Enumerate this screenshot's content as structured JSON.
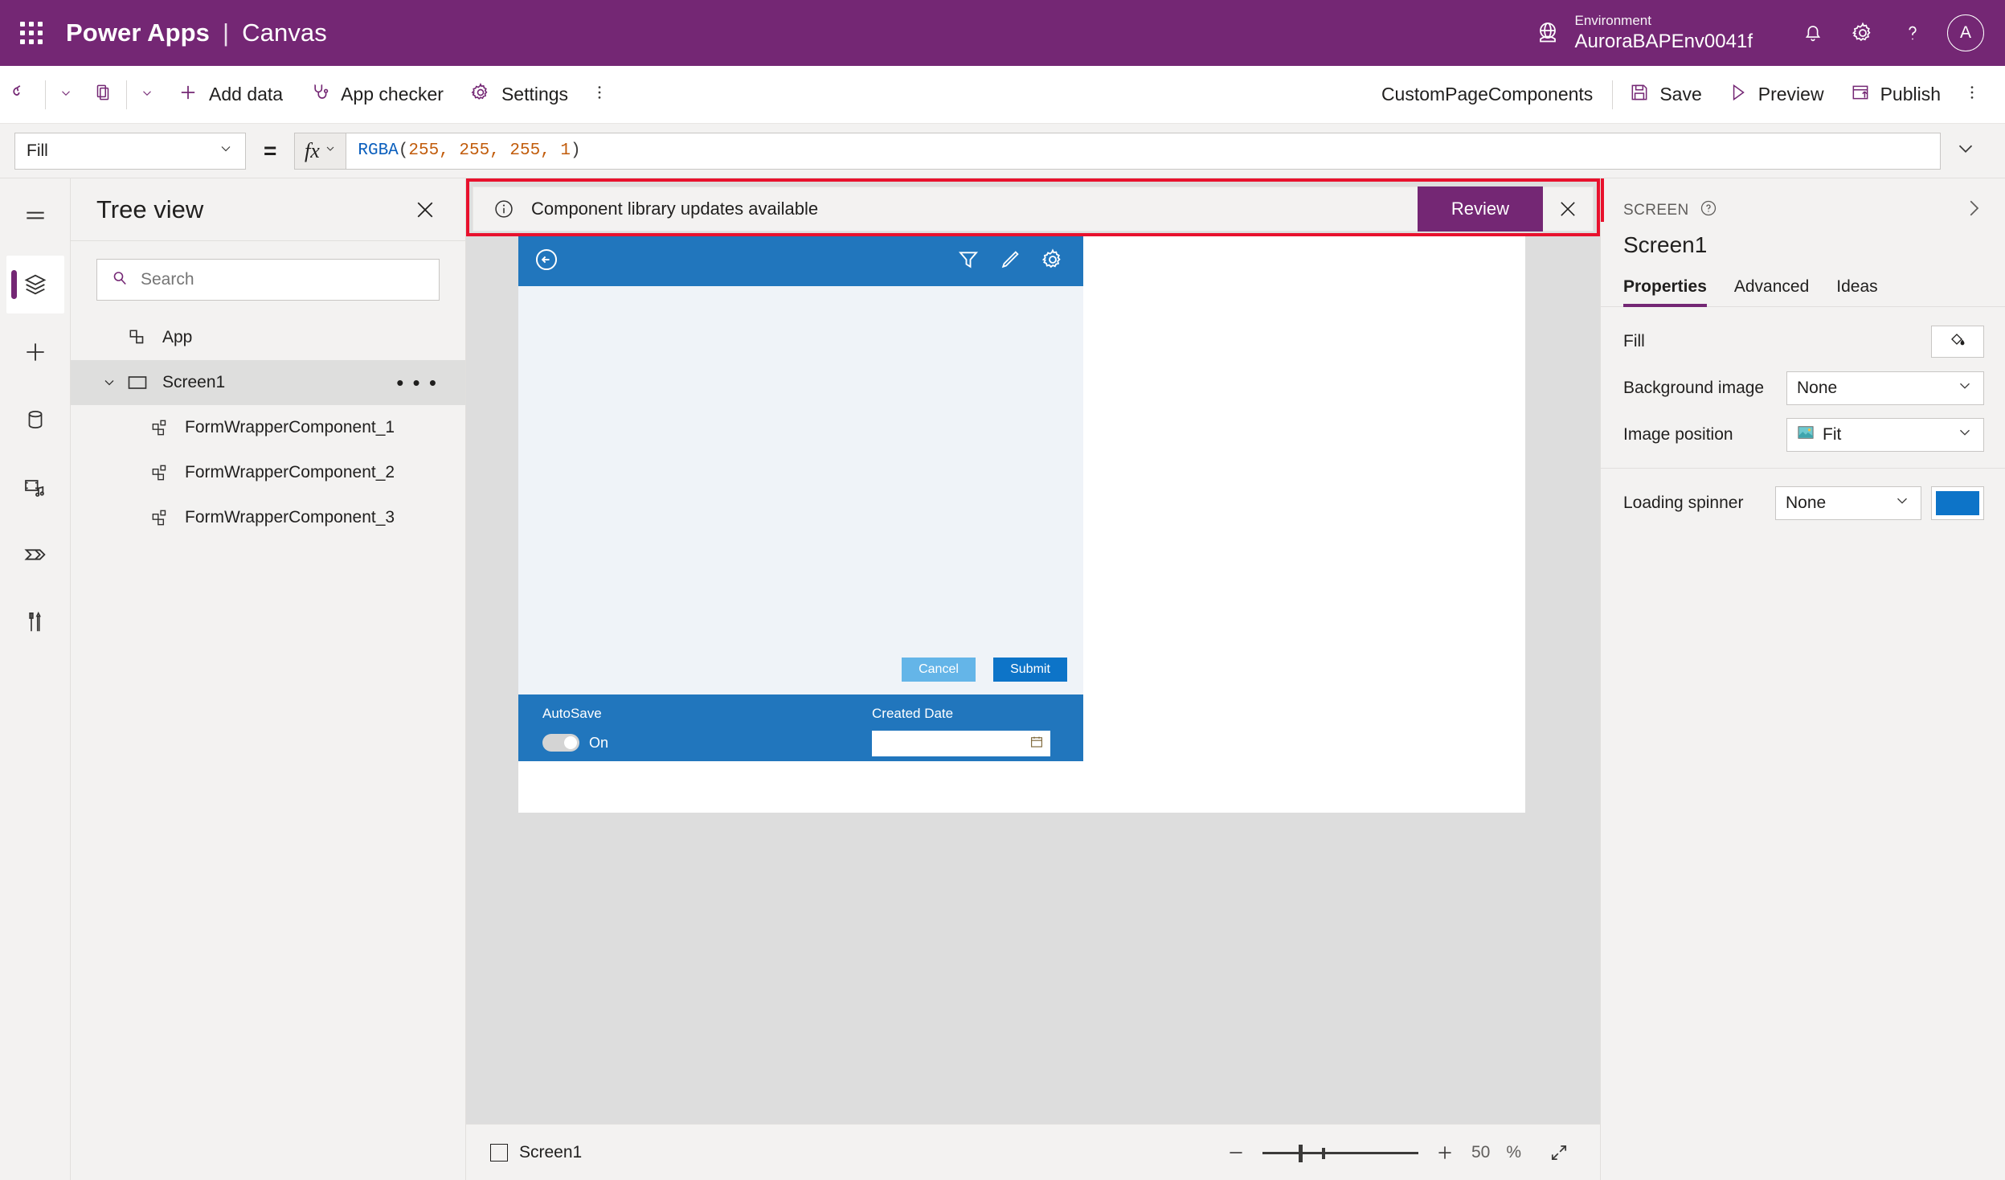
{
  "header": {
    "waffle_icon": "app-launcher-icon",
    "brand": "Power Apps",
    "separator": "|",
    "brand_sub": "Canvas",
    "globe_icon": "environment-globe-icon",
    "environment_label": "Environment",
    "environment_name": "AuroraBAPEnv0041f",
    "bell_icon": "notifications-bell-icon",
    "gear_icon": "settings-gear-icon",
    "help_icon": "help-question-icon",
    "avatar_initial": "A"
  },
  "commandbar": {
    "undo_icon": "undo-arrow-icon",
    "undo_chevron_icon": "chevron-down-icon",
    "paste_icon": "clipboard-paste-icon",
    "paste_chevron_icon": "chevron-down-icon",
    "add_data_icon": "plus-icon",
    "add_data": "Add data",
    "app_checker_icon": "stethoscope-icon",
    "app_checker": "App checker",
    "settings_icon": "gear-icon",
    "settings": "Settings",
    "overflow_icon": "more-vertical-icon",
    "app_name": "CustomPageComponents",
    "save_icon": "save-floppy-icon",
    "save": "Save",
    "preview_icon": "play-triangle-icon",
    "preview": "Preview",
    "publish_icon": "publish-upload-icon",
    "publish": "Publish",
    "right_overflow_icon": "more-vertical-icon"
  },
  "formulabar": {
    "property": "Fill",
    "property_chevron_icon": "chevron-down-icon",
    "equals": "=",
    "fx_label": "fx",
    "fx_chevron_icon": "chevron-down-icon",
    "formula_fn": "RGBA",
    "formula_open": "(",
    "formula_args": "255, 255, 255, 1",
    "formula_close": ")",
    "expand_chevron_icon": "chevron-down-icon"
  },
  "rail": {
    "items": [
      {
        "name": "hamburger-menu-icon",
        "selected": false
      },
      {
        "name": "tree-view-layers-icon",
        "selected": true
      },
      {
        "name": "insert-plus-icon",
        "selected": false
      },
      {
        "name": "data-database-icon",
        "selected": false
      },
      {
        "name": "media-icon",
        "selected": false
      },
      {
        "name": "power-automate-icon",
        "selected": false
      },
      {
        "name": "variables-tools-icon",
        "selected": false
      }
    ]
  },
  "treeview": {
    "title": "Tree view",
    "close_icon": "close-x-icon",
    "search_icon": "search-icon",
    "search_value": "",
    "search_placeholder": "Search",
    "nodes": [
      {
        "label": "App",
        "icon": "app-grid-icon",
        "level": 1,
        "selected": false,
        "expandable": false
      },
      {
        "label": "Screen1",
        "icon": "screen-rect-icon",
        "level": 1,
        "selected": true,
        "expandable": true,
        "chevron_icon": "chevron-down-icon",
        "overflow": "• • •"
      },
      {
        "label": "FormWrapperComponent_1",
        "icon": "component-icon",
        "level": 2,
        "selected": false,
        "expandable": false
      },
      {
        "label": "FormWrapperComponent_2",
        "icon": "component-icon",
        "level": 2,
        "selected": false,
        "expandable": false
      },
      {
        "label": "FormWrapperComponent_3",
        "icon": "component-icon",
        "level": 2,
        "selected": false,
        "expandable": false
      }
    ]
  },
  "notification": {
    "info_icon": "info-circle-icon",
    "message": "Component library updates available",
    "review_label": "Review",
    "close_icon": "close-x-icon",
    "highlight_color": "#e8112d",
    "review_color": "#742774"
  },
  "app_preview": {
    "header": {
      "back_icon": "back-arrow-circle-icon",
      "filter_icon": "filter-funnel-icon",
      "edit_icon": "pencil-edit-icon",
      "settings_icon": "gear-icon",
      "color": "#2176bd"
    },
    "buttons": {
      "cancel": "Cancel",
      "cancel_color": "#64b5e8",
      "submit": "Submit",
      "submit_color": "#0d74c8"
    },
    "footer": {
      "autosave_label": "AutoSave",
      "autosave_state": "On",
      "created_date_label": "Created Date",
      "created_date_value": "",
      "calendar_icon": "calendar-icon",
      "color": "#2176bd"
    }
  },
  "properties": {
    "kind": "SCREEN",
    "help_icon": "help-circle-icon",
    "expand_icon": "chevron-right-icon",
    "name": "Screen1",
    "tabs": [
      {
        "label": "Properties",
        "selected": true
      },
      {
        "label": "Advanced",
        "selected": false
      },
      {
        "label": "Ideas",
        "selected": false
      }
    ],
    "rows": [
      {
        "label": "Fill",
        "control": "fill-swatch",
        "icon": "paint-bucket-icon"
      },
      {
        "label": "Background image",
        "control": "select",
        "value": "None",
        "chevron_icon": "chevron-down-icon"
      },
      {
        "label": "Image position",
        "control": "select",
        "value": "Fit",
        "icon": "image-thumbnail-icon",
        "chevron_icon": "chevron-down-icon"
      },
      {
        "label": "Loading spinner",
        "control": "select-color",
        "value": "None",
        "chevron_icon": "chevron-down-icon",
        "color": "#0d74c8"
      }
    ]
  },
  "statusbar": {
    "screen_icon": "screen-rect-icon",
    "screen_label": "Screen1",
    "zoom_out_icon": "minus-icon",
    "zoom_in_icon": "plus-icon",
    "zoom_value": "50",
    "zoom_unit": "%",
    "fit_icon": "fit-screen-diagonal-icon"
  }
}
